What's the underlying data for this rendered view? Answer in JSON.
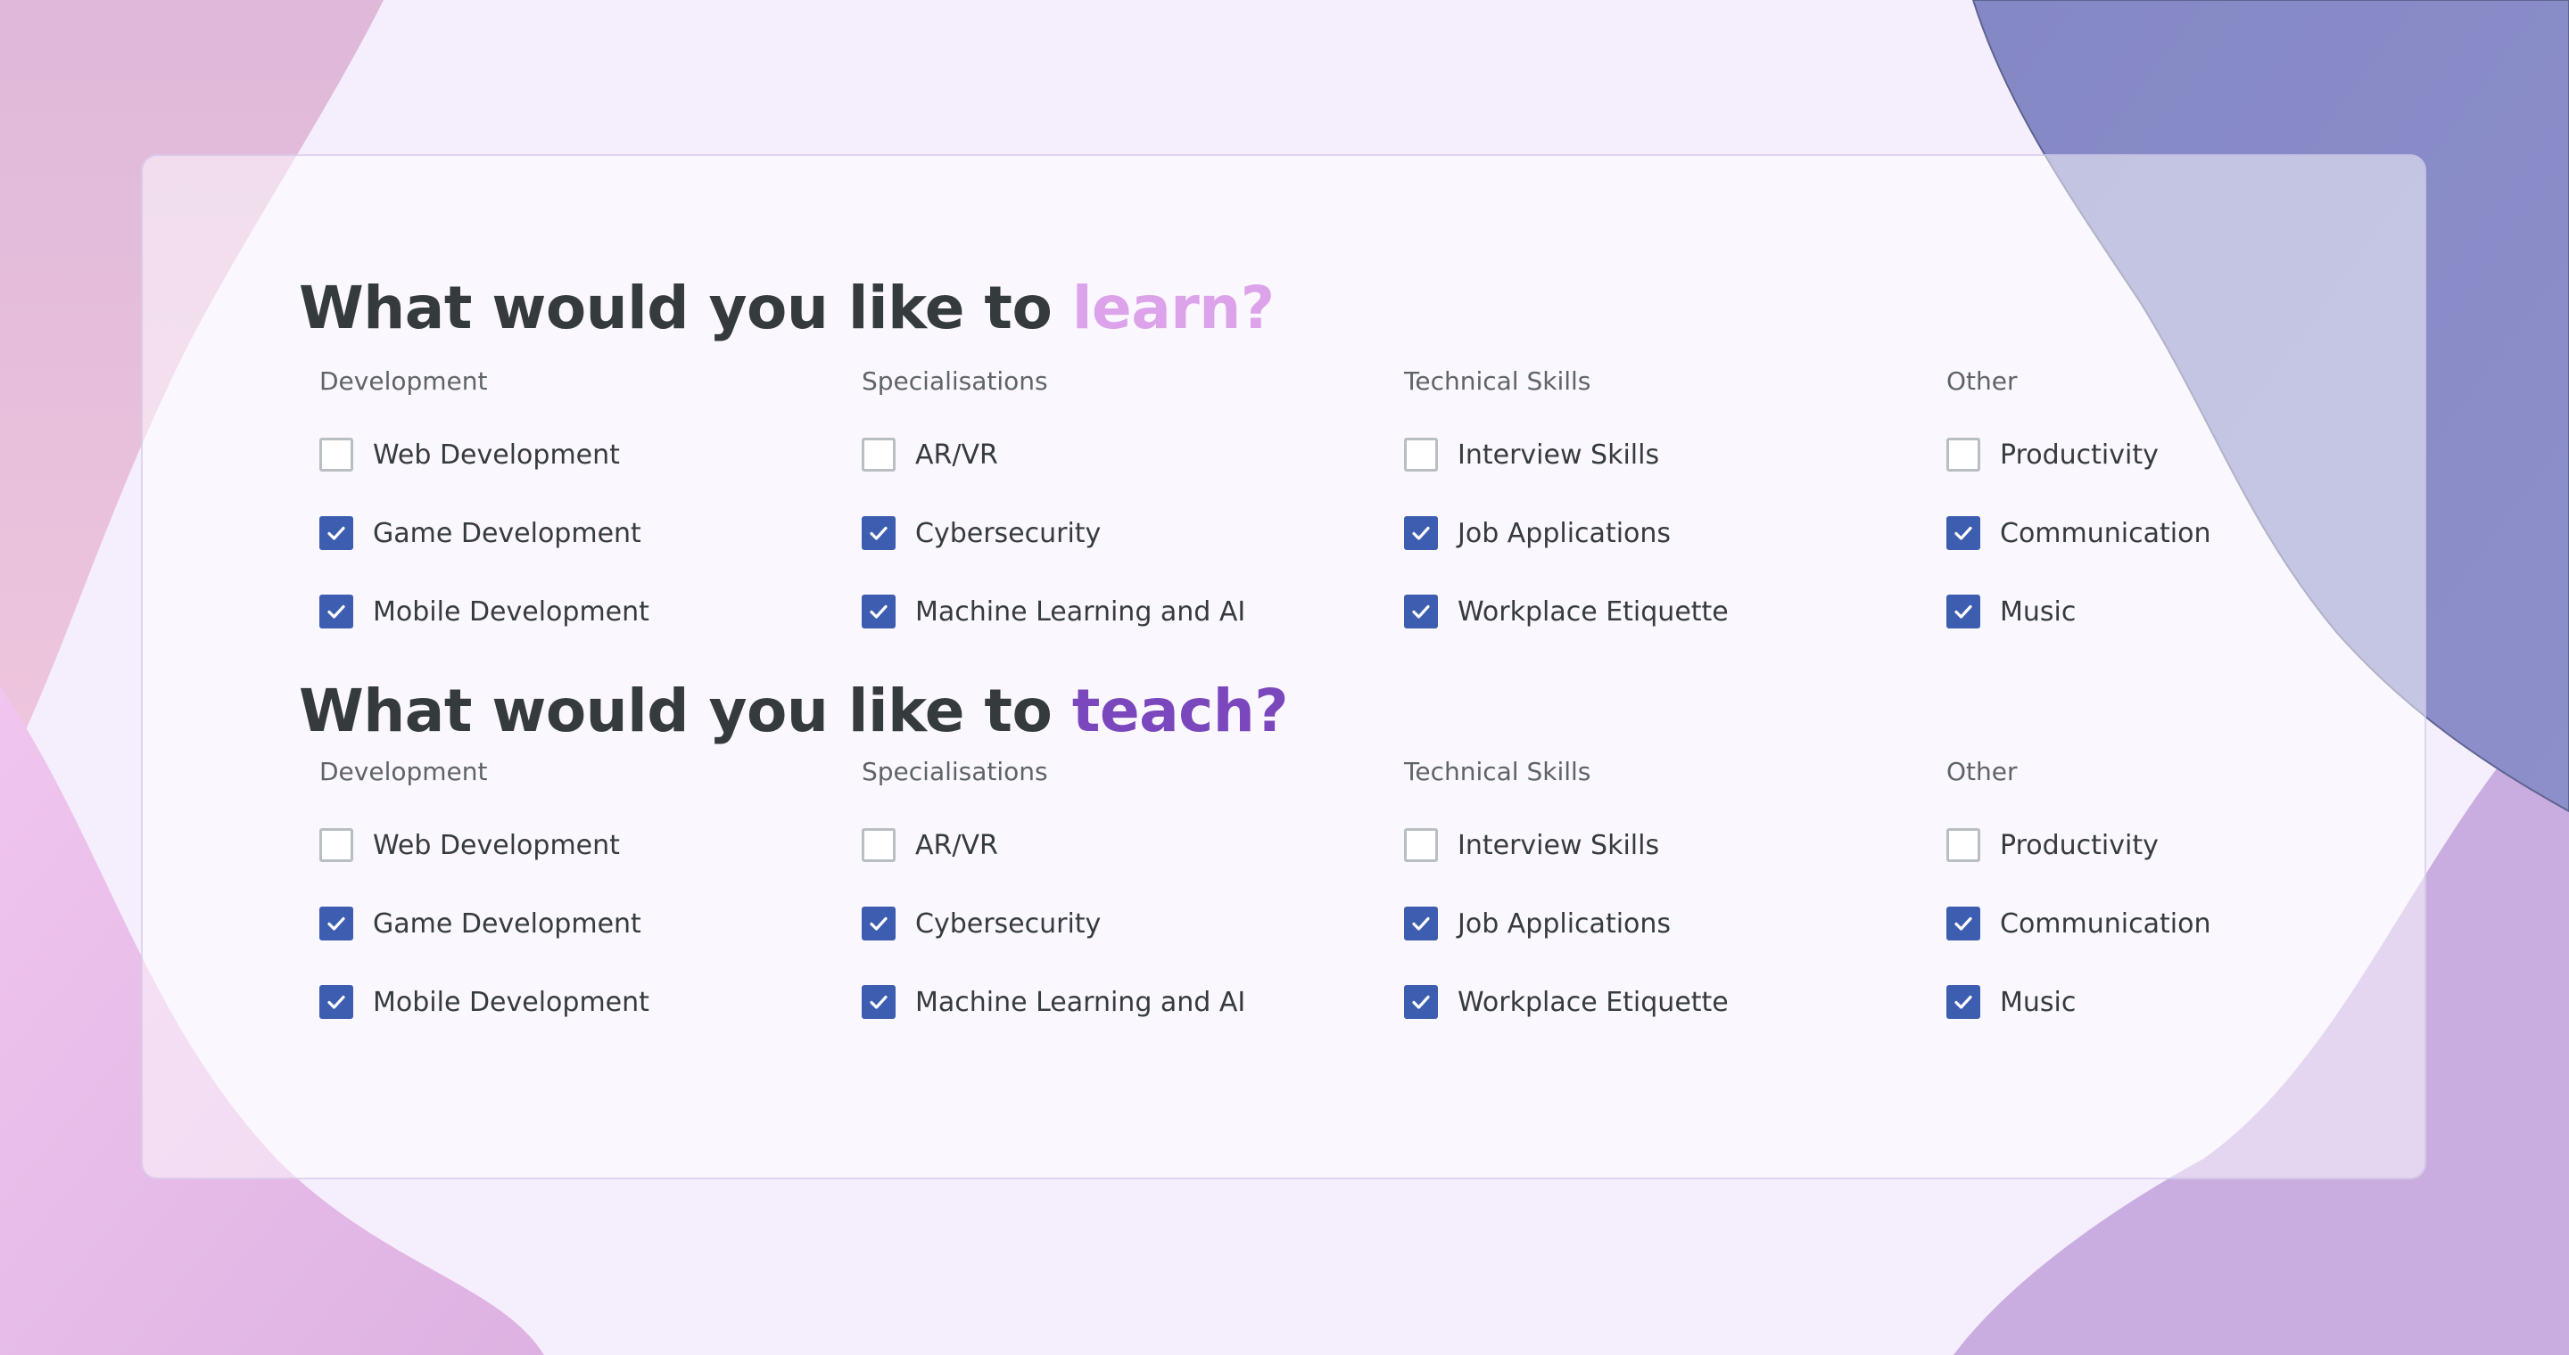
{
  "learn": {
    "title_prefix": "What would you like to ",
    "title_accent": "learn?",
    "columns": [
      {
        "heading": "Development",
        "options": [
          {
            "label": "Web Development",
            "checked": false
          },
          {
            "label": "Game Development",
            "checked": true
          },
          {
            "label": "Mobile Development",
            "checked": true
          }
        ]
      },
      {
        "heading": "Specialisations",
        "options": [
          {
            "label": "AR/VR",
            "checked": false
          },
          {
            "label": "Cybersecurity",
            "checked": true
          },
          {
            "label": "Machine Learning and AI",
            "checked": true
          }
        ]
      },
      {
        "heading": "Technical Skills",
        "options": [
          {
            "label": "Interview Skills",
            "checked": false
          },
          {
            "label": "Job Applications",
            "checked": true
          },
          {
            "label": "Workplace Etiquette",
            "checked": true
          }
        ]
      },
      {
        "heading": "Other",
        "options": [
          {
            "label": "Productivity",
            "checked": false
          },
          {
            "label": "Communication",
            "checked": true
          },
          {
            "label": "Music",
            "checked": true
          }
        ]
      }
    ]
  },
  "teach": {
    "title_prefix": "What would you like to ",
    "title_accent": "teach?",
    "columns": [
      {
        "heading": "Development",
        "options": [
          {
            "label": "Web Development",
            "checked": false
          },
          {
            "label": "Game Development",
            "checked": true
          },
          {
            "label": "Mobile Development",
            "checked": true
          }
        ]
      },
      {
        "heading": "Specialisations",
        "options": [
          {
            "label": "AR/VR",
            "checked": false
          },
          {
            "label": "Cybersecurity",
            "checked": true
          },
          {
            "label": "Machine Learning and AI",
            "checked": true
          }
        ]
      },
      {
        "heading": "Technical Skills",
        "options": [
          {
            "label": "Interview Skills",
            "checked": false
          },
          {
            "label": "Job Applications",
            "checked": true
          },
          {
            "label": "Workplace Etiquette",
            "checked": true
          }
        ]
      },
      {
        "heading": "Other",
        "options": [
          {
            "label": "Productivity",
            "checked": false
          },
          {
            "label": "Communication",
            "checked": true
          },
          {
            "label": "Music",
            "checked": true
          }
        ]
      }
    ]
  },
  "colors": {
    "background": "#f5eefd",
    "checkbox_checked": "#3d5eb0",
    "checkbox_unchecked_border": "#b9bec2",
    "accent_learn": "#dca2ea",
    "accent_teach": "#7b47bc",
    "heading_text": "#353b3d"
  }
}
